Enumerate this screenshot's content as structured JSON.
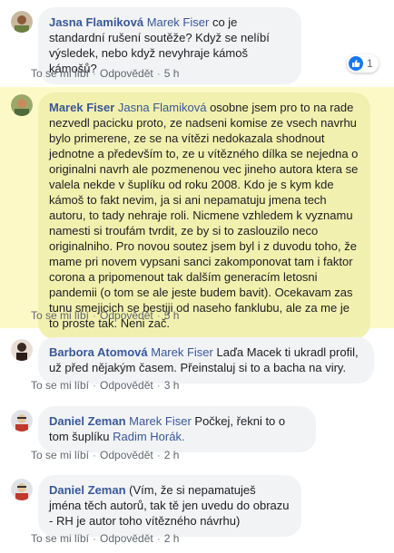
{
  "comments": [
    {
      "author": "Jasna Flamiková",
      "mention": "Marek Fiser",
      "text": "co je standardní rušení soutěže? Když se nelíbí výsledek, nebo když nevyhraje kámoš kámošů?",
      "like": "To se mi líbí",
      "reply": "Odpovědět",
      "time": "5 h",
      "reactions": "1"
    },
    {
      "author": "Marek Fiser",
      "mention": "Jasna Flamiková",
      "text": "osobne jsem pro to na rade nezvedl pacicku proto, ze nadseni komise ze vsech navrhu bylo primerene, ze se na vítězi nedokazala shodnout jednotne a především to, ze u vítězného dílka se nejedna o originalni navrh ale pozmenenou vec jineho autora ktera se valela nekde v šuplíku od roku 2008. Kdo je s kym kde kámoš to fakt nevim, ja si ani nepamatuju jmena tech autoru, to tady nehraje roli. Nicmene vzhledem k vyznamu namesti si troufám tvrdit, ze by si to zaslouzilo neco originalniho. Pro novou soutez jsem byl i z duvodu toho, že mame pri novem vypsani sanci zakomponovat tam i faktor corona a pripomenout tak dalším generacím letosni pandemii (o tom se ale jeste budem bavit). Ocekavam zas tunu smejicich se bestiji od naseho fanklubu, ale za me je to proste tak. Neni zač.",
      "like": "To se mi líbí",
      "reply": "Odpovědět",
      "time": "5 h"
    },
    {
      "author": "Barbora Atomová",
      "mention": "Marek Fiser",
      "text": "Laďa Macek ti ukradl profil, už před nějakým časem. Přeinstaluj si to a bacha na viry.",
      "like": "To se mi líbí",
      "reply": "Odpovědět",
      "time": "3 h"
    },
    {
      "author": "Daniel Zeman",
      "mention": "Marek Fiser",
      "text": "Počkej, řekni to o tom šuplíku",
      "mention2": "Radim Horák.",
      "like": "To se mi líbí",
      "reply": "Odpovědět",
      "time": "2 h"
    },
    {
      "author": "Daniel Zeman",
      "text": "(Vím, že si nepamatuješ jména těch autorů, tak tě jen uvedu do obrazu - RH je autor toho vítězného návrhu)",
      "like": "To se mi líbí",
      "reply": "Odpovědět",
      "time": "2 h"
    }
  ],
  "colors": {
    "name_blue": "#385898",
    "bubble_gray": "#f2f3f5",
    "highlight_bg": "#fdf9c7",
    "highlight_bubble": "#f2f0ae",
    "like_blue": "#1877f2"
  },
  "icons": {
    "reaction": "thumbs-up-icon"
  }
}
